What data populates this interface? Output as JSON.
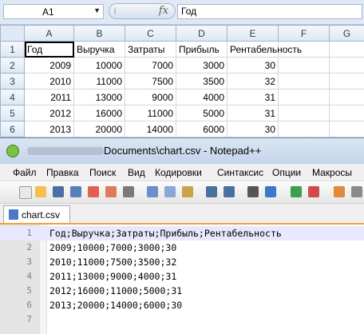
{
  "excel": {
    "name_box": "A1",
    "fx_label": "fx",
    "formula": "Год",
    "columns": [
      "A",
      "B",
      "C",
      "D",
      "E",
      "F",
      "G"
    ],
    "rows": [
      {
        "num": "1",
        "cells": [
          "Год",
          "Выручка",
          "Затраты",
          "Прибыль",
          "Рентабельность",
          "",
          ""
        ]
      },
      {
        "num": "2",
        "cells": [
          "2009",
          "10000",
          "7000",
          "3000",
          "30",
          "",
          ""
        ]
      },
      {
        "num": "3",
        "cells": [
          "2010",
          "11000",
          "7500",
          "3500",
          "32",
          "",
          ""
        ]
      },
      {
        "num": "4",
        "cells": [
          "2011",
          "13000",
          "9000",
          "4000",
          "31",
          "",
          ""
        ]
      },
      {
        "num": "5",
        "cells": [
          "2012",
          "16000",
          "11000",
          "5000",
          "31",
          "",
          ""
        ]
      },
      {
        "num": "6",
        "cells": [
          "2013",
          "20000",
          "14000",
          "6000",
          "30",
          "",
          ""
        ]
      }
    ]
  },
  "notepad": {
    "title": "Documents\\chart.csv - Notepad++",
    "menu": [
      "Файл",
      "Правка",
      "Поиск",
      "Вид",
      "Кодировки",
      "Синтаксис",
      "Опции",
      "Макросы"
    ],
    "tab": "chart.csv",
    "lines": [
      {
        "n": "1",
        "text": "Год;Выручка;Затраты;Прибыль;Рентабельность"
      },
      {
        "n": "2",
        "text": "2009;10000;7000;3000;30"
      },
      {
        "n": "3",
        "text": "2010;11000;7500;3500;32"
      },
      {
        "n": "4",
        "text": "2011;13000;9000;4000;31"
      },
      {
        "n": "5",
        "text": "2012;16000;11000;5000;31"
      },
      {
        "n": "6",
        "text": "2013;20000;14000;6000;30"
      },
      {
        "n": "7",
        "text": ""
      }
    ]
  }
}
